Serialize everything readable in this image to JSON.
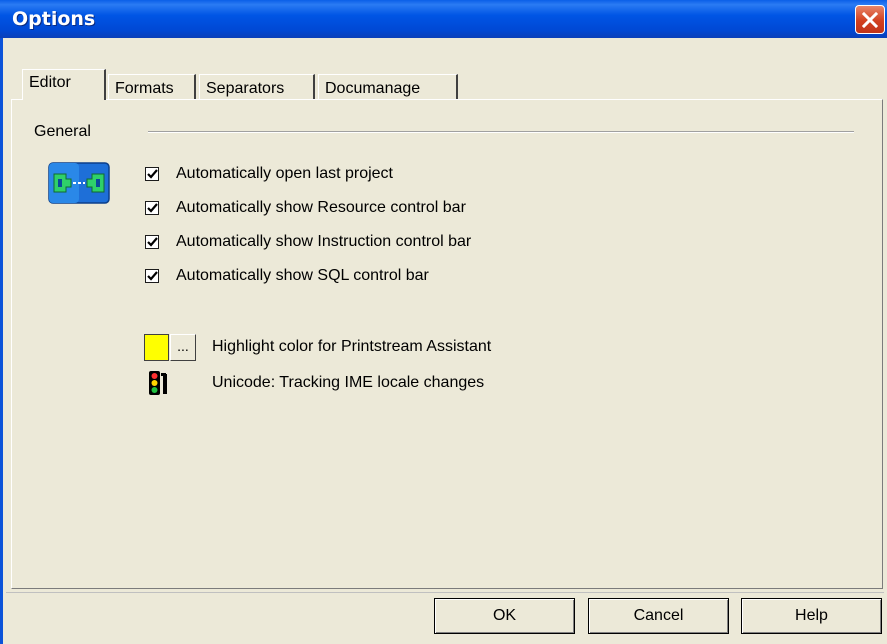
{
  "window": {
    "title": "Options"
  },
  "tabs": [
    {
      "label": "Editor",
      "active": true
    },
    {
      "label": "Formats"
    },
    {
      "label": "Separators"
    },
    {
      "label": "Documanage"
    }
  ],
  "general": {
    "label": "General",
    "checkboxes": [
      {
        "label": "Automatically open last project",
        "checked": true
      },
      {
        "label": "Automatically show Resource control bar",
        "checked": true
      },
      {
        "label": "Automatically show Instruction control bar",
        "checked": true
      },
      {
        "label": "Automatically show SQL control bar",
        "checked": true
      }
    ],
    "highlight": {
      "label": "Highlight color for Printstream Assistant",
      "color": "#ffff00",
      "button_label": "..."
    },
    "unicode": {
      "label": "Unicode: Tracking IME locale changes"
    }
  },
  "buttons": {
    "ok": "OK",
    "cancel": "Cancel",
    "help": "Help"
  },
  "colors": {
    "titlebar": "#0055e5",
    "close": "#d2401f",
    "face": "#ece9d8"
  },
  "icons": [
    "close-icon",
    "editor-general-icon",
    "traffic-light-icon",
    "checkmark-icon"
  ]
}
